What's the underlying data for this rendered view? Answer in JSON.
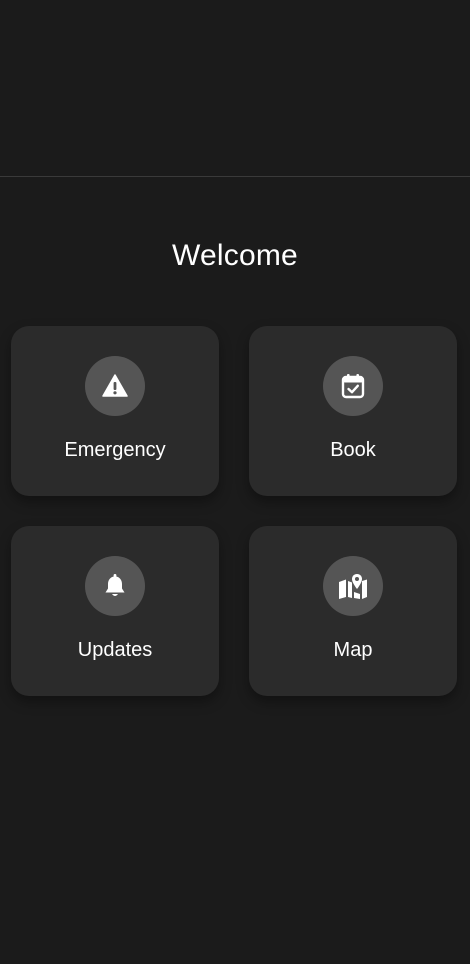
{
  "header": {
    "title": "Welcome"
  },
  "tiles": [
    {
      "label": "Emergency",
      "icon": "warning-icon"
    },
    {
      "label": "Book",
      "icon": "calendar-check-icon"
    },
    {
      "label": "Updates",
      "icon": "bell-icon"
    },
    {
      "label": "Map",
      "icon": "map-pin-icon"
    }
  ],
  "colors": {
    "background": "#1b1b1b",
    "tile": "#2b2b2b",
    "icon_circle": "#555555",
    "text": "#ffffff",
    "divider": "#3a3a3a"
  }
}
